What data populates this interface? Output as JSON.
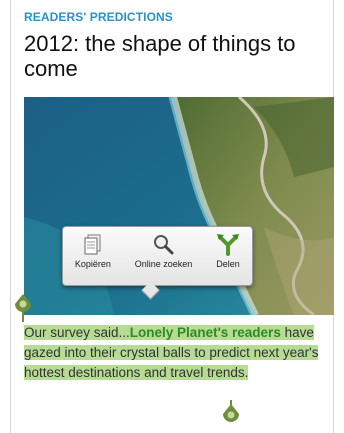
{
  "article": {
    "kicker": "READERS' PREDICTIONS",
    "headline": "2012: the shape of things to come",
    "body_prefix": "Our survey said...",
    "body_link": "Lonely Planet's readers",
    "body_suffix": " have gazed into their crystal balls to predict next year's hottest destinations and travel trends."
  },
  "selection_menu": {
    "items": [
      {
        "label": "Kopiëren",
        "icon": "copy-icon"
      },
      {
        "label": "Online zoeken",
        "icon": "search-icon"
      },
      {
        "label": "Delen",
        "icon": "share-icon"
      }
    ]
  },
  "colors": {
    "kicker": "#2f8fc7",
    "highlight": "#b6dc94",
    "link": "#2f8a23",
    "handle": "#6f8e3c"
  }
}
